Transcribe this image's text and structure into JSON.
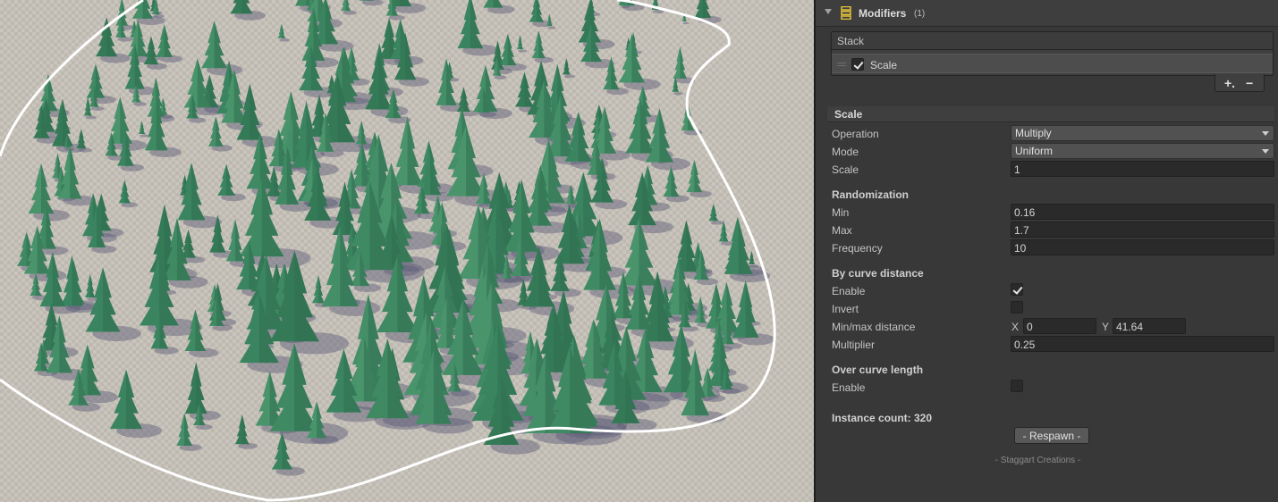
{
  "component": {
    "title": "Modifiers",
    "count": "(1)"
  },
  "stack": {
    "header": "Stack",
    "items": [
      {
        "label": "Scale",
        "enabled": true
      }
    ],
    "add_label": "+.",
    "remove_label": "−"
  },
  "scale_section": {
    "title": "Scale",
    "operation_label": "Operation",
    "operation_value": "Multiply",
    "mode_label": "Mode",
    "mode_value": "Uniform",
    "scale_label": "Scale",
    "scale_value": "1"
  },
  "randomization": {
    "title": "Randomization",
    "min_label": "Min",
    "min_value": "0.16",
    "max_label": "Max",
    "max_value": "1.7",
    "frequency_label": "Frequency",
    "frequency_value": "10"
  },
  "curve_distance": {
    "title": "By curve distance",
    "enable_label": "Enable",
    "enable_value": true,
    "invert_label": "Invert",
    "invert_value": false,
    "minmax_label": "Min/max distance",
    "x_label": "X",
    "x_value": "0",
    "y_label": "Y",
    "y_value": "41.64",
    "multiplier_label": "Multiplier",
    "multiplier_value": "0.25"
  },
  "curve_length": {
    "title": "Over curve length",
    "enable_label": "Enable",
    "enable_value": false
  },
  "instance_count": "Instance count: 320",
  "respawn_label": "- Respawn -",
  "credit": "- Staggart Creations -",
  "scene": {
    "tree_color": "#3f8a63",
    "ground_color": "#c9c4bc",
    "spline_color": "#ffffff"
  }
}
